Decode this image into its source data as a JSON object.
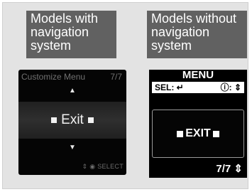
{
  "left_panel": {
    "title_lines": [
      "Models with",
      "navigation",
      "system"
    ],
    "screen": {
      "header_title": "Customize Menu",
      "header_page": "7/7",
      "up_arrow": "▲",
      "item": "Exit",
      "down_arrow": "▼",
      "footer": "⇕ ◉ SELECT"
    }
  },
  "right_panel": {
    "title_lines": [
      "Models without",
      "navigation",
      "system"
    ],
    "screen": {
      "title": "MENU",
      "sel_label": "SEL: ↵",
      "info_label": "ⓘ: ⇕",
      "item": "EXIT",
      "page": "7/7 ⇕"
    }
  },
  "colors": {
    "background": "#e3e3e3",
    "title_box": "#616161",
    "screen_bg": "#000000"
  }
}
